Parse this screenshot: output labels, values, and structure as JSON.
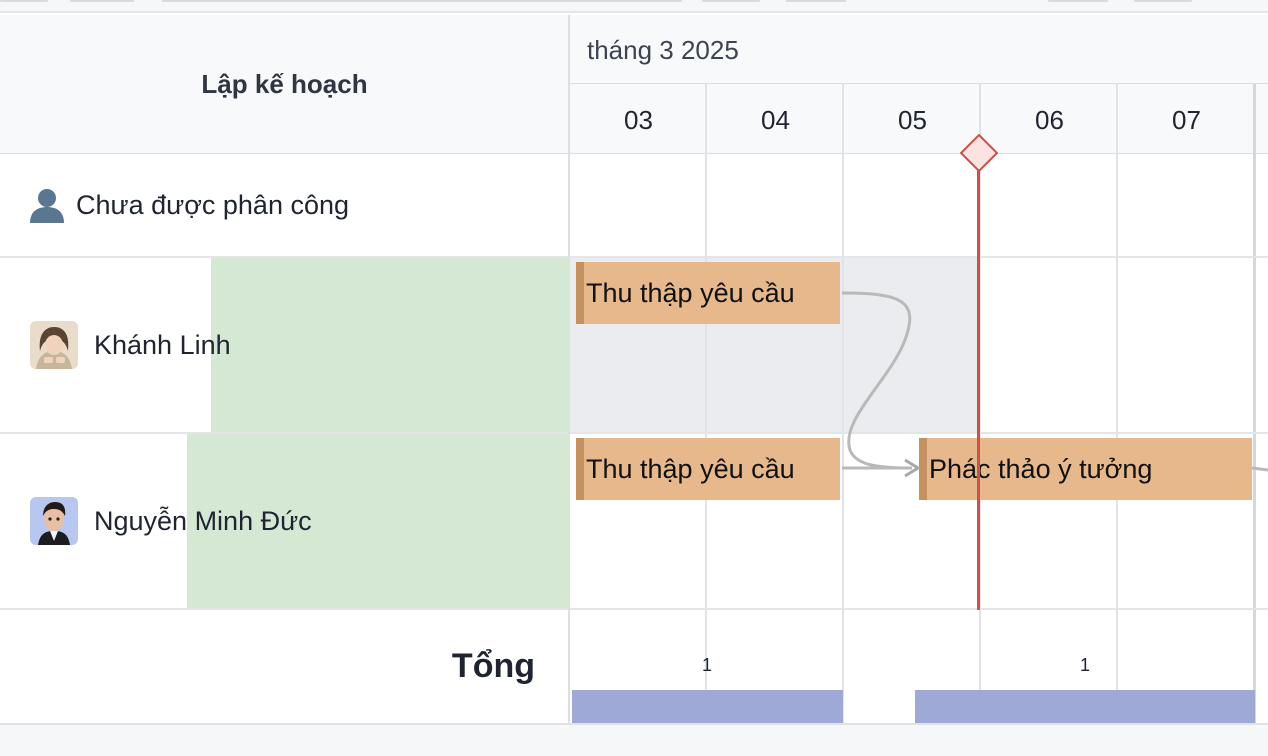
{
  "header": {
    "left_title": "Lập kế hoạch",
    "month_label": "tháng 3 2025",
    "days": [
      "03",
      "04",
      "05",
      "06",
      "07"
    ]
  },
  "resources": [
    {
      "name": "Chưa được phân công",
      "icon": "person-icon"
    },
    {
      "name": "Khánh Linh",
      "icon": "avatar-photo"
    },
    {
      "name": "Nguyễn Minh Đức",
      "icon": "avatar-memoji"
    }
  ],
  "tasks": [
    {
      "label": "Thu thập yêu cầu",
      "resource": "Khánh Linh",
      "start": "03",
      "end": "04"
    },
    {
      "label": "Thu thập yêu cầu",
      "resource": "Nguyễn Minh Đức",
      "start": "03",
      "end": "04"
    },
    {
      "label": "Phác thảo ý tưởng",
      "resource": "Nguyễn Minh Đức",
      "start": "05",
      "end": "07"
    }
  ],
  "totals": {
    "label": "Tổng",
    "counts": [
      "1",
      "1"
    ]
  },
  "colors": {
    "task_fill": "#e6b88c",
    "task_edge": "#c49160",
    "today_line": "#c9524a",
    "load_bar": "#d5e8d4",
    "total_bar": "#9ea9d5"
  }
}
